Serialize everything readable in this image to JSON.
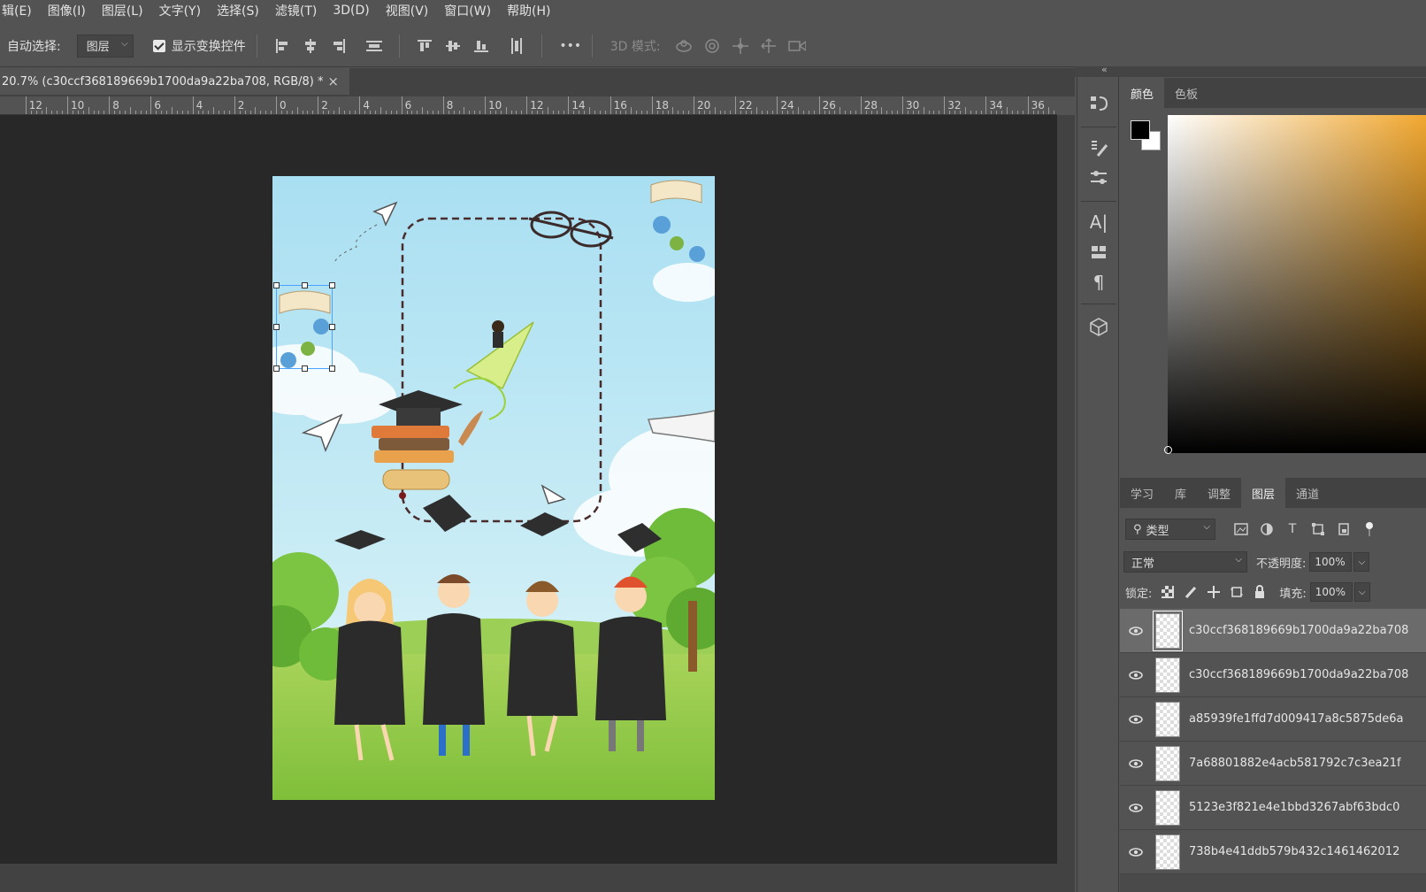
{
  "menu": [
    "辑(E)",
    "图像(I)",
    "图层(L)",
    "文字(Y)",
    "选择(S)",
    "滤镜(T)",
    "3D(D)",
    "视图(V)",
    "窗口(W)",
    "帮助(H)"
  ],
  "options": {
    "auto_select_label": "自动选择:",
    "auto_select_value": "图层",
    "show_transform_label": "显示变换控件",
    "more_label": "•••",
    "mode_3d_label": "3D 模式:"
  },
  "document": {
    "tab_title": "20.7% (c30ccf368189669b1700da9a22ba708, RGB/8) *",
    "close_glyph": "×"
  },
  "ruler": {
    "labels": [
      "12",
      "10",
      "8",
      "6",
      "4",
      "2",
      "0",
      "2",
      "4",
      "6",
      "8",
      "10",
      "12",
      "14",
      "16",
      "18",
      "20",
      "22",
      "24",
      "26",
      "28",
      "30",
      "32",
      "34",
      "36"
    ]
  },
  "color_panel": {
    "tabs": [
      "颜色",
      "色板"
    ],
    "active_tab": 0,
    "foreground": "#000000",
    "background": "#ffffff",
    "hue": "#f2a830"
  },
  "layers_panel": {
    "tabs": [
      "学习",
      "库",
      "调整",
      "图层",
      "通道"
    ],
    "active_tab": 3,
    "filter_kind": "类型",
    "blend_mode": "正常",
    "opacity_label": "不透明度:",
    "opacity_value": "100%",
    "lock_label": "锁定:",
    "fill_label": "填充:",
    "fill_value": "100%",
    "layers": [
      {
        "name": "c30ccf368189669b1700da9a22ba708",
        "visible": true,
        "selected": true
      },
      {
        "name": "c30ccf368189669b1700da9a22ba708",
        "visible": true,
        "selected": false
      },
      {
        "name": "a85939fe1ffd7d009417a8c5875de6a",
        "visible": true,
        "selected": false
      },
      {
        "name": "7a68801882e4acb581792c7c3ea21f",
        "visible": true,
        "selected": false
      },
      {
        "name": "5123e3f821e4e1bbd3267abf63bdc0",
        "visible": true,
        "selected": false
      },
      {
        "name": "738b4e41ddb579b432c1461462012",
        "visible": true,
        "selected": false
      }
    ]
  }
}
